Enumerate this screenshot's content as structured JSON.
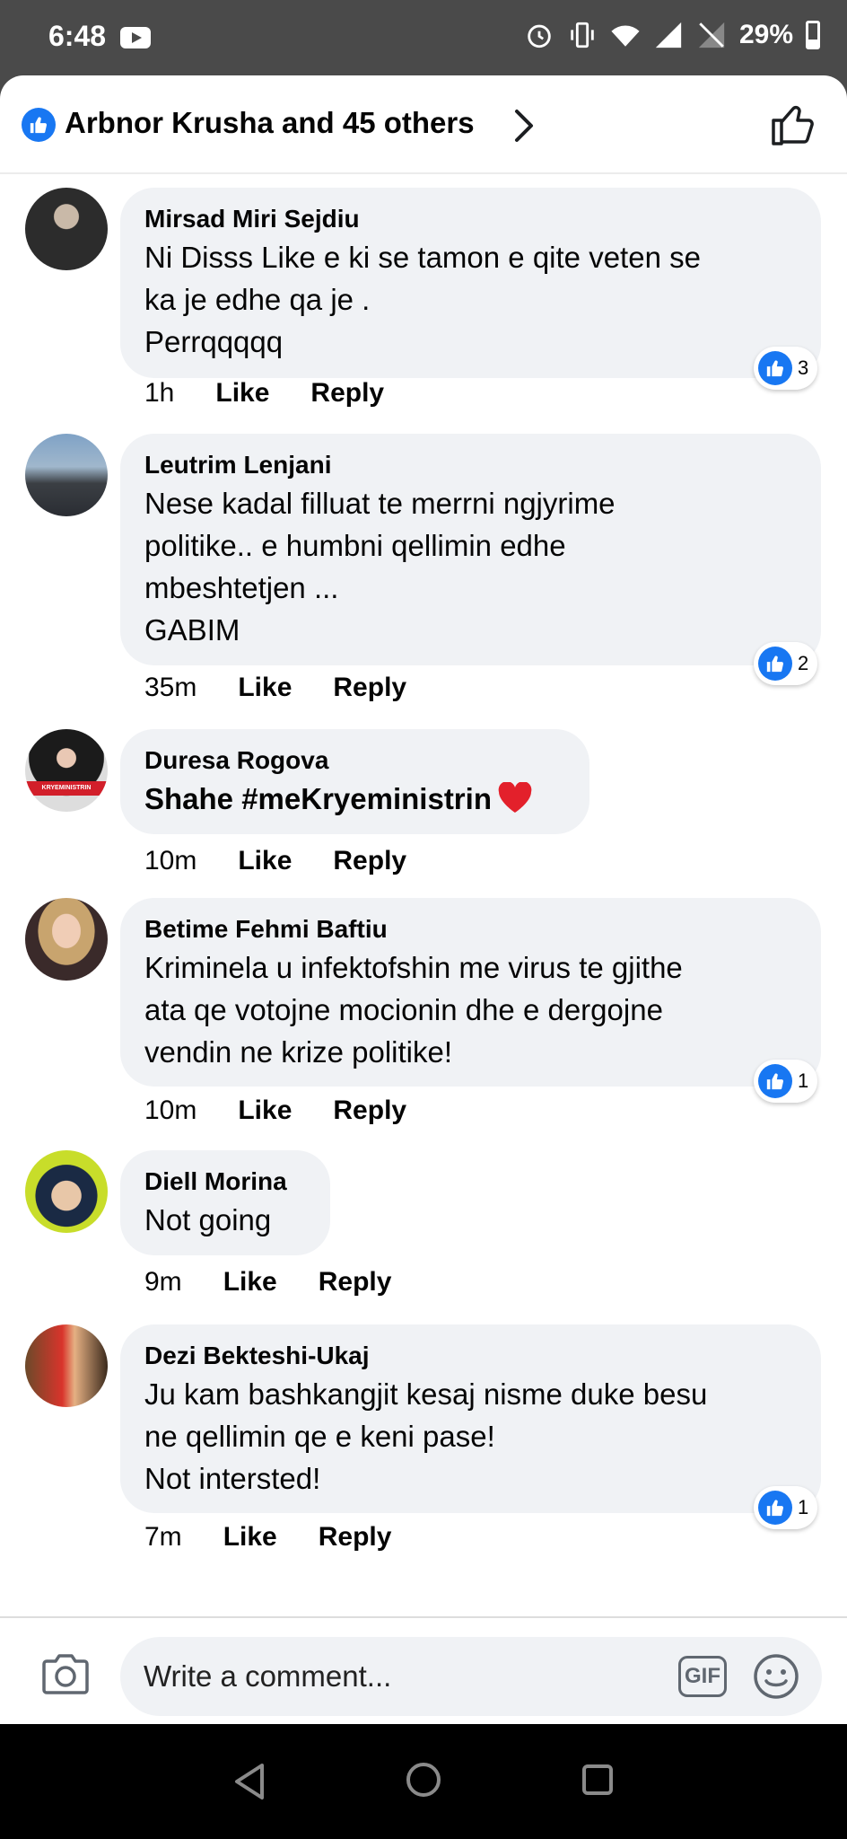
{
  "status_bar": {
    "time": "6:48",
    "battery": "29%"
  },
  "reactions_header": {
    "text": "Arbnor Krusha and 45 others"
  },
  "comments": [
    {
      "author": "Mirsad Miri Sejdiu",
      "text": "Ni Disss Like  e ki se tamon e qite veten se\nka je edhe qa je .\nPerrqqqqq",
      "time": "1h",
      "like_label": "Like",
      "reply_label": "Reply",
      "reactions": "3"
    },
    {
      "author": "Leutrim Lenjani",
      "text": "Nese kadal filluat te merrni ngjyrime\npolitike.. e humbni qellimin edhe\nmbeshtetjen ...\nGABIM",
      "time": "35m",
      "like_label": "Like",
      "reply_label": "Reply",
      "reactions": "2"
    },
    {
      "author": "Duresa Rogova",
      "text": "Shahe #meKryeministrin",
      "time": "10m",
      "like_label": "Like",
      "reply_label": "Reply",
      "avatar_text": "KRYEMINISTRIN"
    },
    {
      "author": "Betime Fehmi Baftiu",
      "text": "Kriminela u infektofshin me virus te gjithe\nata qe votojne mocionin dhe e dergojne\nvendin ne krize politike!",
      "time": "10m",
      "like_label": "Like",
      "reply_label": "Reply",
      "reactions": "1"
    },
    {
      "author": "Diell Morina",
      "text": "Not going",
      "time": "9m",
      "like_label": "Like",
      "reply_label": "Reply"
    },
    {
      "author": "Dezi Bekteshi-Ukaj",
      "text": "Ju kam bashkangjit kesaj nisme duke besu\nne qellimin qe e keni pase!\nNot intersted!",
      "time": "7m",
      "like_label": "Like",
      "reply_label": "Reply",
      "reactions": "1"
    }
  ],
  "composer": {
    "placeholder": "Write a comment...",
    "gif_label": "GIF"
  },
  "icons": {
    "header_like": "like-icon",
    "header_thumb": "thumbs-up-outline-icon",
    "camera": "camera-icon",
    "emoji": "emoji-icon",
    "heart": "red-heart-icon"
  },
  "colors": {
    "brand_blue": "#1877f2",
    "bubble": "#f0f2f5",
    "heart_red": "#e3202b"
  }
}
